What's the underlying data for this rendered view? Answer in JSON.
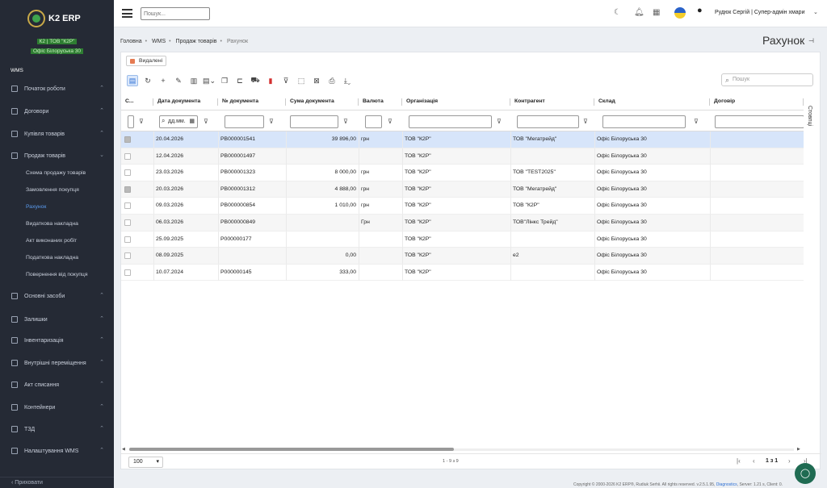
{
  "app": {
    "name": "K2 ERP",
    "company": "К2 | ТОВ \"К2Р\"",
    "office": "Офіс Білоруська 30"
  },
  "sidebar": {
    "section": "WMS",
    "items": [
      {
        "label": "Початок роботи"
      },
      {
        "label": "Договори"
      },
      {
        "label": "Купівля товарів"
      },
      {
        "label": "Продаж товарів"
      },
      {
        "label": "Основні засоби"
      },
      {
        "label": "Залишки"
      },
      {
        "label": "Інвентаризація"
      },
      {
        "label": "Внутрішні переміщення"
      },
      {
        "label": "Акт списання"
      },
      {
        "label": "Контейнери"
      },
      {
        "label": "ТЗД"
      },
      {
        "label": "Налаштування WMS"
      }
    ],
    "subitems": [
      {
        "label": "Схема продажу товарів"
      },
      {
        "label": "Замовлення покупця"
      },
      {
        "label": "Рахунок"
      },
      {
        "label": "Видаткова накладна"
      },
      {
        "label": "Акт виконаних робіт"
      },
      {
        "label": "Податкова накладна"
      },
      {
        "label": "Повернення від покупця"
      }
    ],
    "footer": "Приховати"
  },
  "topbar": {
    "search_placeholder": "Пошук...",
    "user": "Рудюк Сергій | Супер-адмін хмари"
  },
  "breadcrumb": [
    "Головна",
    "WMS",
    "Продаж товарів",
    "Рахунок"
  ],
  "page_title": "Рахунок",
  "deleted_label": "Видалені",
  "grid_search_placeholder": "Пошук",
  "side_tab": "Стовпці",
  "table": {
    "headers": [
      "С...",
      "Дата документа",
      "№ документа",
      "Сума документа",
      "Валюта",
      "Організація",
      "Контрагент",
      "Склад",
      "Договір"
    ],
    "date_filter": "дд.мм.",
    "rows": [
      {
        "checked": true,
        "date": "20.04.2026",
        "num": "РВ000001541",
        "sum": "39 896,00",
        "cur": "грн",
        "org": "ТОВ \"К2Р\"",
        "contr": "ТОВ \"Мегатрейд\"",
        "stock": "Офіс Білоруська 30"
      },
      {
        "checked": false,
        "date": "12.04.2026",
        "num": "РВ000001497",
        "sum": "",
        "cur": "",
        "org": "ТОВ \"К2Р\"",
        "contr": "",
        "stock": "Офіс Білоруська 30"
      },
      {
        "checked": false,
        "date": "23.03.2026",
        "num": "РВ000001323",
        "sum": "8 000,00",
        "cur": "грн",
        "org": "ТОВ \"К2Р\"",
        "contr": "ТОВ \"TEST2025\"",
        "stock": "Офіс Білоруська 30"
      },
      {
        "checked": true,
        "date": "20.03.2026",
        "num": "РВ000001312",
        "sum": "4 888,00",
        "cur": "грн",
        "org": "ТОВ \"К2Р\"",
        "contr": "ТОВ \"Мегатрейд\"",
        "stock": "Офіс Білоруська 30"
      },
      {
        "checked": false,
        "date": "09.03.2026",
        "num": "РВ000000854",
        "sum": "1 010,00",
        "cur": "грн",
        "org": "ТОВ \"К2Р\"",
        "contr": "ТОВ \"К2Р\"",
        "stock": "Офіс Білоруська 30"
      },
      {
        "checked": false,
        "date": "06.03.2026",
        "num": "РВ000000849",
        "sum": "",
        "cur": "Грн",
        "org": "ТОВ \"К2Р\"",
        "contr": "ТОВ\"Лінкс Трейд\"",
        "stock": "Офіс Білоруська 30"
      },
      {
        "checked": false,
        "date": "25.09.2025",
        "num": "Р000000177",
        "sum": "",
        "cur": "",
        "org": "ТОВ \"К2Р\"",
        "contr": "",
        "stock": "Офіс Білоруська 30"
      },
      {
        "checked": false,
        "date": "08.09.2025",
        "num": "",
        "sum": "0,00",
        "cur": "",
        "org": "ТОВ \"К2Р\"",
        "contr": "е2",
        "stock": "Офіс Білоруська 30"
      },
      {
        "checked": false,
        "date": "10.07.2024",
        "num": "Р000000145",
        "sum": "333,00",
        "cur": "",
        "org": "ТОВ \"К2Р\"",
        "contr": "",
        "stock": "Офіс Білоруська 30"
      }
    ]
  },
  "pagination": {
    "page_size": "100",
    "info": "1 - 9 з 9",
    "pages": "1 з 1"
  },
  "copyright": "Copyright © 2000-2026 K2 ERP®, Rudiuk Serhii. All rights reserved. v.2.5.1.95,",
  "diagnostics": "Diagnostics",
  "server": "Server: 1.21 s, Client: 0."
}
